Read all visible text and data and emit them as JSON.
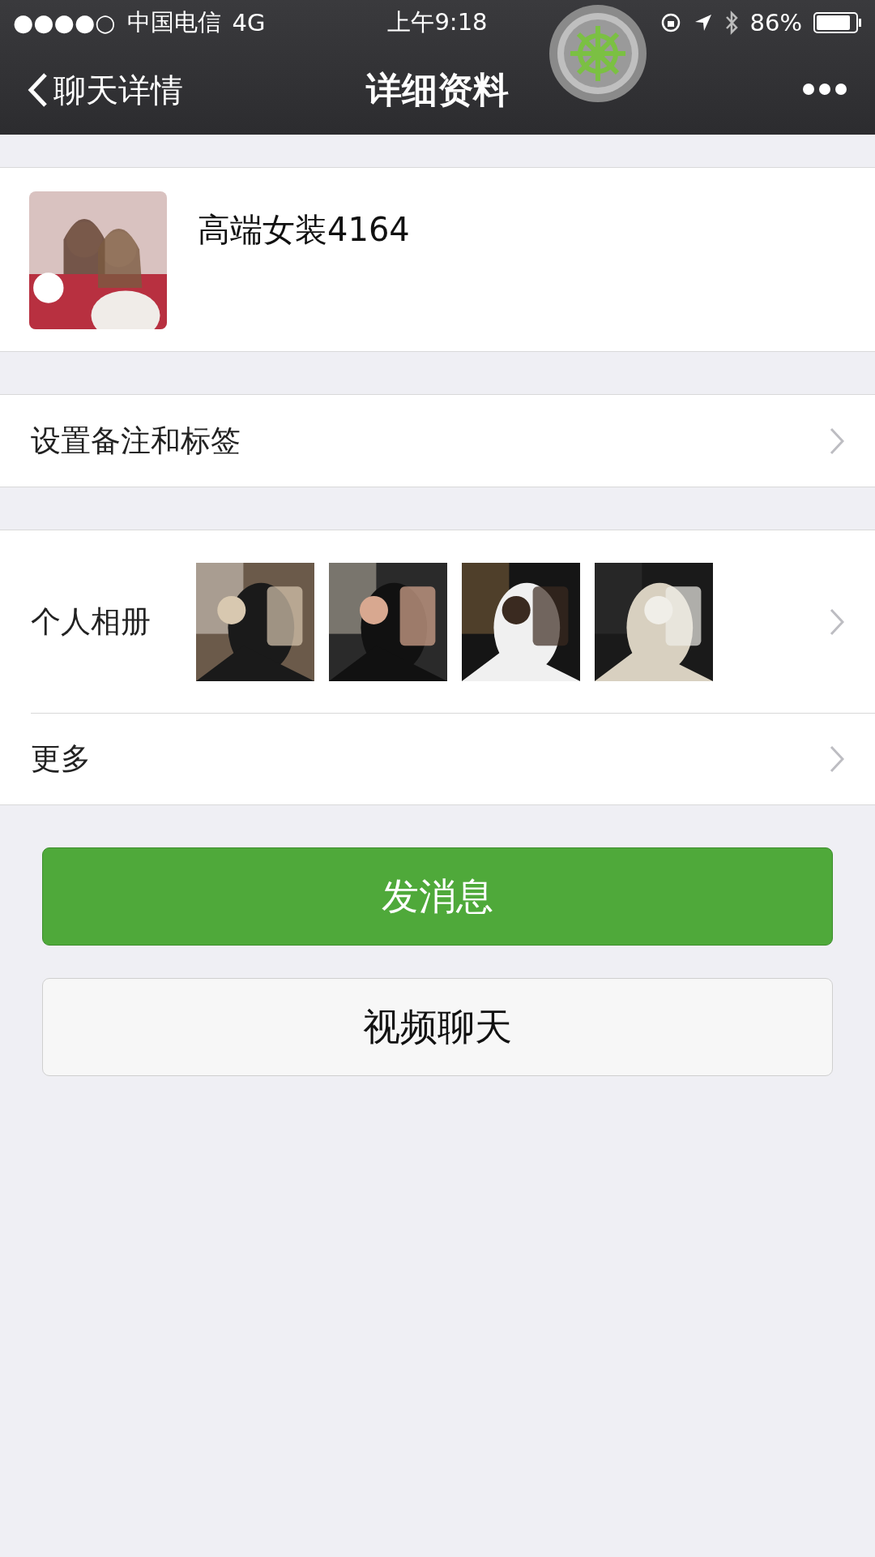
{
  "status_bar": {
    "signal": "●●●●○",
    "carrier": "中国电信",
    "network": "4G",
    "time": "上午9:18",
    "battery": "86%"
  },
  "nav": {
    "back": "聊天详情",
    "title": "详细资料"
  },
  "profile": {
    "name": "高端女装4164"
  },
  "rows": [
    {
      "kind": "plain",
      "label": "设置备注和标签"
    },
    {
      "kind": "album",
      "label": "个人相册"
    },
    {
      "kind": "plain",
      "label": "更多"
    }
  ],
  "buttons": [
    {
      "kind": "primary",
      "label": "发消息"
    },
    {
      "kind": "secondary",
      "label": "视频聊天"
    }
  ]
}
